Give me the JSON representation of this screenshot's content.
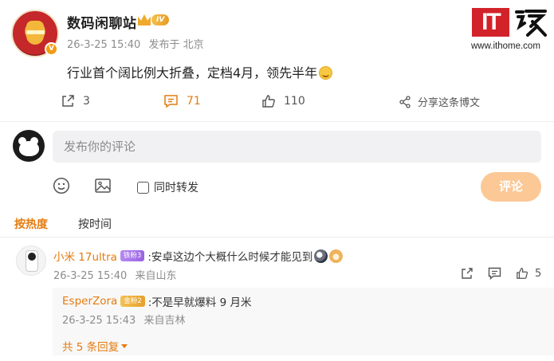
{
  "post": {
    "username": "数码闲聊站",
    "level_badge": "IV",
    "verified_badge": "V",
    "time": "26-3-25 15:40",
    "location": "发布于 北京",
    "content": "行业首个阔比例大折叠，定档4月，领先半年"
  },
  "logo": {
    "it_text": "IT",
    "chinese_text": "之家",
    "url": "www.ithome.com"
  },
  "actions": {
    "share_count": "3",
    "comment_count": "71",
    "like_count": "110",
    "forward_label": "分享这条博文"
  },
  "composer": {
    "placeholder": "发布你的评论",
    "repost_label": "同时转发",
    "submit_label": "评论"
  },
  "sort_tabs": {
    "hot": "按热度",
    "time": "按时间"
  },
  "comments": [
    {
      "username": "小米 17ultra",
      "badge": "铁粉3",
      "text": ":安卓这边个大概什么时候才能见到",
      "time": "26-3-25 15:40",
      "location": "来自山东",
      "like_count": "5",
      "replies": [
        {
          "username": "EsperZora",
          "badge": "金粉2",
          "text": ":不是早就爆料 9 月米",
          "time": "26-3-25 15:43",
          "location": "来自吉林"
        }
      ],
      "more_replies_label": "共 5 条回复"
    }
  ],
  "colors": {
    "accent": "#e47b10",
    "submit_bg": "#fbc896",
    "brand_red": "#d2232a"
  }
}
